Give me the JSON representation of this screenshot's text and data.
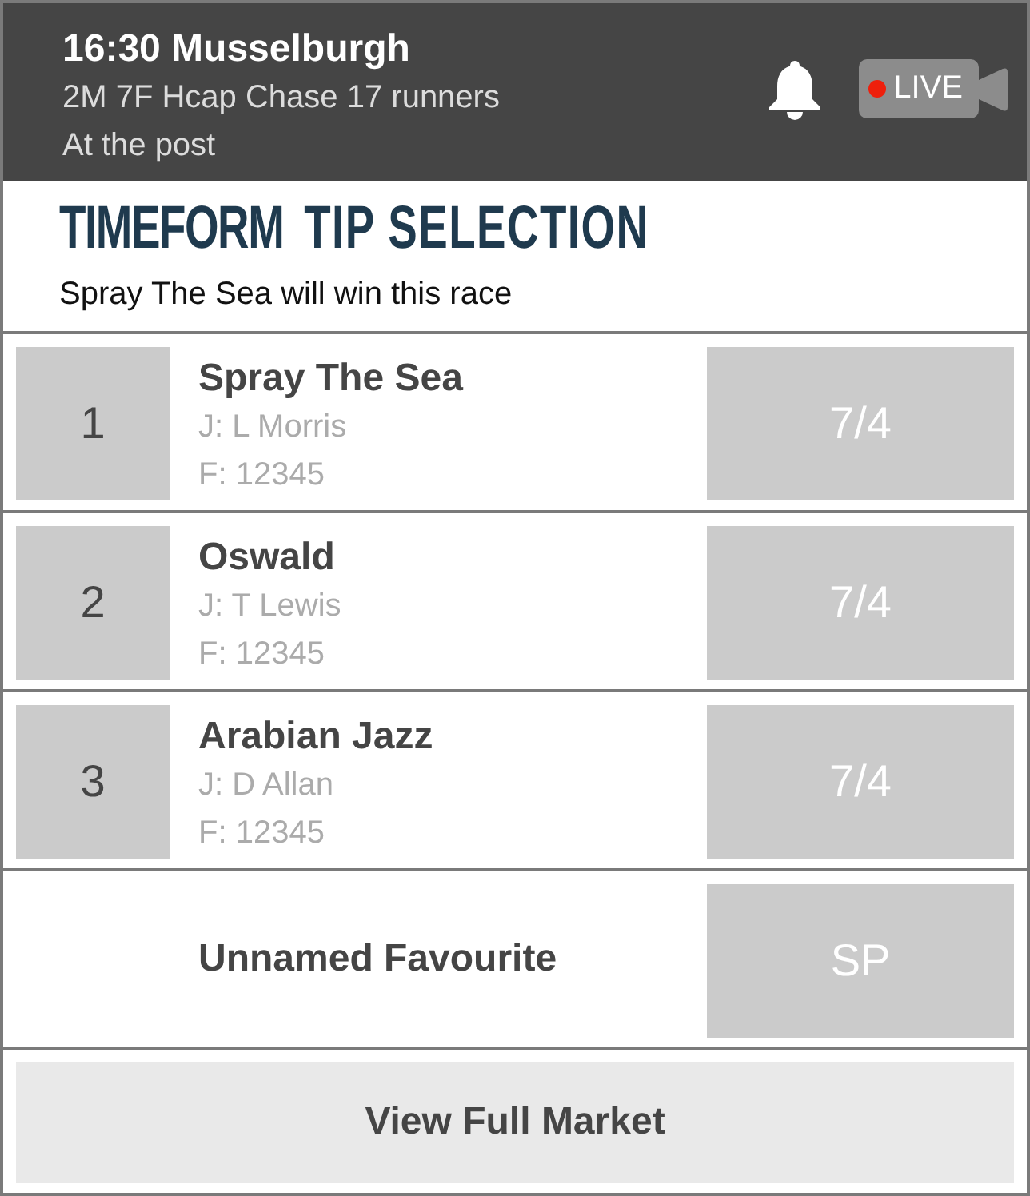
{
  "header": {
    "title": "16:30 Musselburgh",
    "subtitle": "2M 7F Hcap Chase 17 runners",
    "status": "At the post",
    "live": {
      "label": "LIVE"
    }
  },
  "tip": {
    "logo": "TIMEFORM",
    "heading": "TIP SELECTION",
    "text": "Spray The Sea will win this race"
  },
  "runners": [
    {
      "kind": "runner",
      "number": "1",
      "name": "Spray The Sea",
      "jockey": "J: L Morris",
      "form": "F: 12345",
      "odds": "7/4"
    },
    {
      "kind": "runner",
      "number": "2",
      "name": "Oswald",
      "jockey": "J: T Lewis",
      "form": "F: 12345",
      "odds": "7/4"
    },
    {
      "kind": "runner",
      "number": "3",
      "name": "Arabian Jazz",
      "jockey": "J: D Allan",
      "form": "F: 12345",
      "odds": "7/4"
    },
    {
      "kind": "favourite",
      "name": "Unnamed Favourite",
      "odds": "SP"
    }
  ],
  "market_button": {
    "label": "View Full Market"
  }
}
